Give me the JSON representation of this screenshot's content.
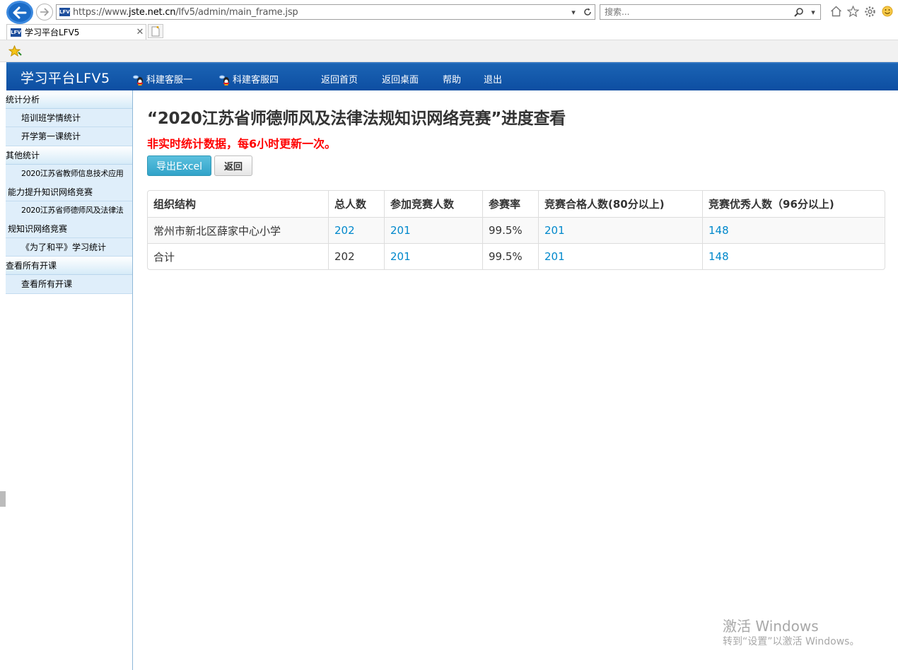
{
  "browser": {
    "url_prefix": "https://www.",
    "url_domain": "jste.net.cn",
    "url_path": "/lfv5/admin/main_frame.jsp",
    "search_placeholder": "搜索...",
    "tab_title": "学习平台LFV5",
    "site_icon_text": "LFV"
  },
  "header": {
    "app_title": "学习平台LFV5",
    "service_links": [
      "科建客服一",
      "科建客服四"
    ],
    "nav_links": [
      "返回首页",
      "返回桌面",
      "帮助",
      "退出"
    ]
  },
  "sidebar": {
    "groups": [
      {
        "title": "统计分析",
        "items": [
          [
            "培训班学情统计"
          ],
          [
            "开学第一课统计"
          ]
        ]
      },
      {
        "title": "其他统计",
        "items": [
          [
            "2020江苏省教师信息技术应用",
            "能力提升知识网络竞赛"
          ],
          [
            "2020江苏省师德师风及法律法",
            "规知识网络竞赛"
          ],
          [
            "《为了和平》学习统计"
          ]
        ]
      },
      {
        "title": "查看所有开课",
        "items": [
          [
            "查看所有开课"
          ]
        ]
      }
    ]
  },
  "main": {
    "title": "“2020江苏省师德师风及法律法规知识网络竞赛”进度查看",
    "notice": "非实时统计数据，每6小时更新一次。",
    "export_button": "导出Excel",
    "back_button": "返回",
    "table": {
      "headers": [
        "组织结构",
        "总人数",
        "参加竞赛人数",
        "参赛率",
        "竞赛合格人数(80分以上)",
        "竞赛优秀人数（96分以上)"
      ],
      "rows": [
        [
          "常州市新北区薛家中心小学",
          "202",
          "201",
          "99.5%",
          "201",
          "148"
        ],
        [
          "合计",
          "202",
          "201",
          "99.5%",
          "201",
          "148"
        ]
      ]
    }
  },
  "watermark": {
    "line1": "激活 Windows",
    "line2": "转到“设置”以激活 Windows。"
  }
}
